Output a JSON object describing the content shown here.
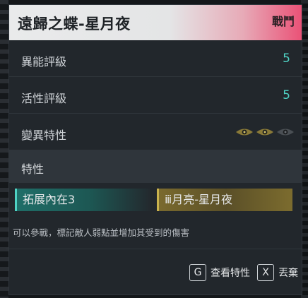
{
  "header": {
    "title": "遠歸之蝶-星月夜",
    "tag": "戰鬥"
  },
  "stats": [
    {
      "label": "異能評級",
      "value": "5"
    },
    {
      "label": "活性評級",
      "value": "5"
    }
  ],
  "mutation": {
    "label": "變異特性",
    "eye_icons": [
      "eye-icon-active",
      "eye-icon-active",
      "eye-icon-inactive"
    ],
    "eye_level": "2/3"
  },
  "traits_section": {
    "label": "特性"
  },
  "traits": [
    {
      "label": "拓展內在3",
      "color": "#1f6e68"
    },
    {
      "label": "ⅲ月亮-星月夜",
      "color": "#7a6a2e"
    }
  ],
  "description": "可以參戰，標記敵人弱點並增加其受到的傷害",
  "footer": {
    "view": {
      "key": "G",
      "label": "查看特性"
    },
    "discard": {
      "key": "X",
      "label": "丟棄"
    }
  },
  "colors": {
    "accent": "#4fd2c4",
    "header_pink": "#ea5277",
    "gold": "#c9b24d"
  }
}
